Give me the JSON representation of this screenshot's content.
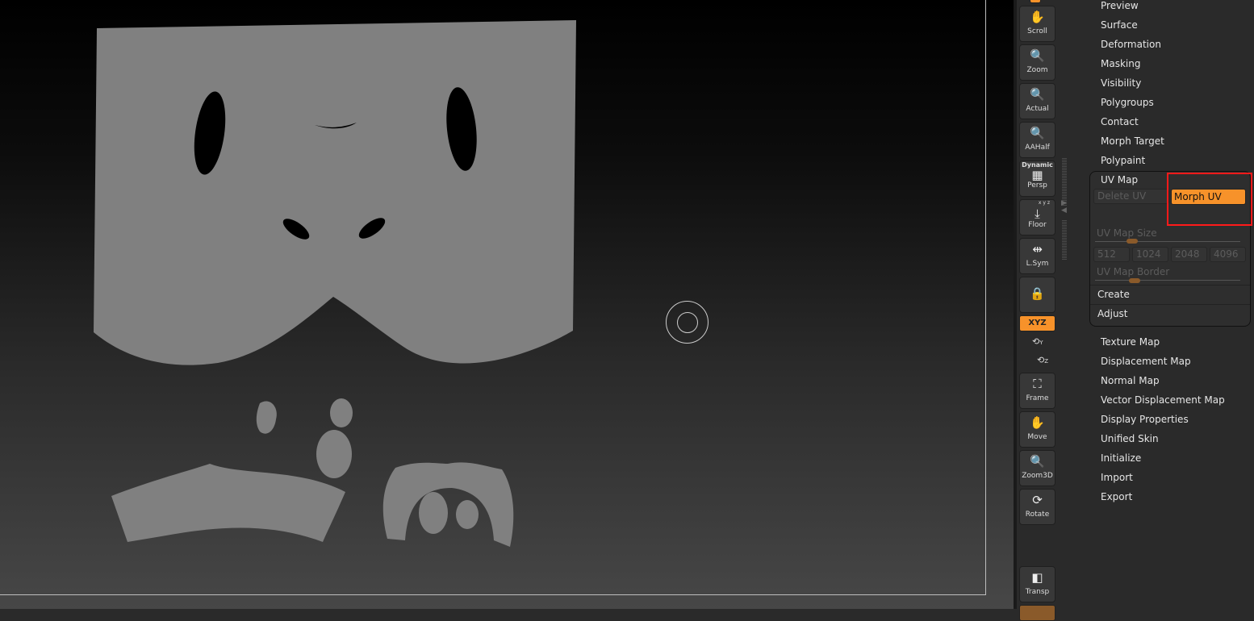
{
  "toolbar": {
    "items": [
      {
        "label": "Scroll",
        "icon": "hand-scroll-icon"
      },
      {
        "label": "Zoom",
        "icon": "zoom-icon"
      },
      {
        "label": "Actual",
        "icon": "zoom-actual-icon"
      },
      {
        "label": "AAHalf",
        "icon": "aahalf-icon"
      },
      {
        "label": "Persp",
        "top": "Dynamic",
        "icon": "perspective-grid-icon"
      },
      {
        "label": "Floor",
        "top": "x y z",
        "icon": "floor-icon"
      },
      {
        "label": "L.Sym",
        "icon": "local-symmetry-icon"
      },
      {
        "label": "",
        "icon": "camera-lock-icon"
      },
      {
        "label": "Frame",
        "icon": "frame-icon"
      },
      {
        "label": "Move",
        "icon": "move-icon"
      },
      {
        "label": "Zoom3D",
        "icon": "zoom3d-icon"
      },
      {
        "label": "Rotate",
        "icon": "rotate-icon"
      },
      {
        "label": "Transp",
        "icon": "transparency-icon"
      }
    ],
    "xyz_label": "XYZ",
    "y_label": "Y",
    "z_label": "Z"
  },
  "menu": {
    "items_top": [
      "Preview",
      "Surface",
      "Deformation",
      "Masking",
      "Visibility",
      "Polygroups",
      "Contact",
      "Morph Target",
      "Polypaint"
    ],
    "items_bottom": [
      "Texture Map",
      "Displacement Map",
      "Normal Map",
      "Vector Displacement Map",
      "Display Properties",
      "Unified Skin",
      "Initialize",
      "Import",
      "Export"
    ]
  },
  "uv_map": {
    "title": "UV Map",
    "delete_uv": "Delete UV",
    "morph_uv": "Morph UV",
    "map_size_label": "UV Map Size",
    "map_size_value_fraction": 0.33,
    "sizes": [
      "512",
      "1024",
      "2048",
      "4096"
    ],
    "border_label": "UV Map Border",
    "border_value_fraction": 0.3,
    "create": "Create",
    "adjust": "Adjust"
  },
  "colors": {
    "accent": "#f7922a",
    "highlight": "#ff1a1a",
    "uv_fill": "#808080"
  }
}
